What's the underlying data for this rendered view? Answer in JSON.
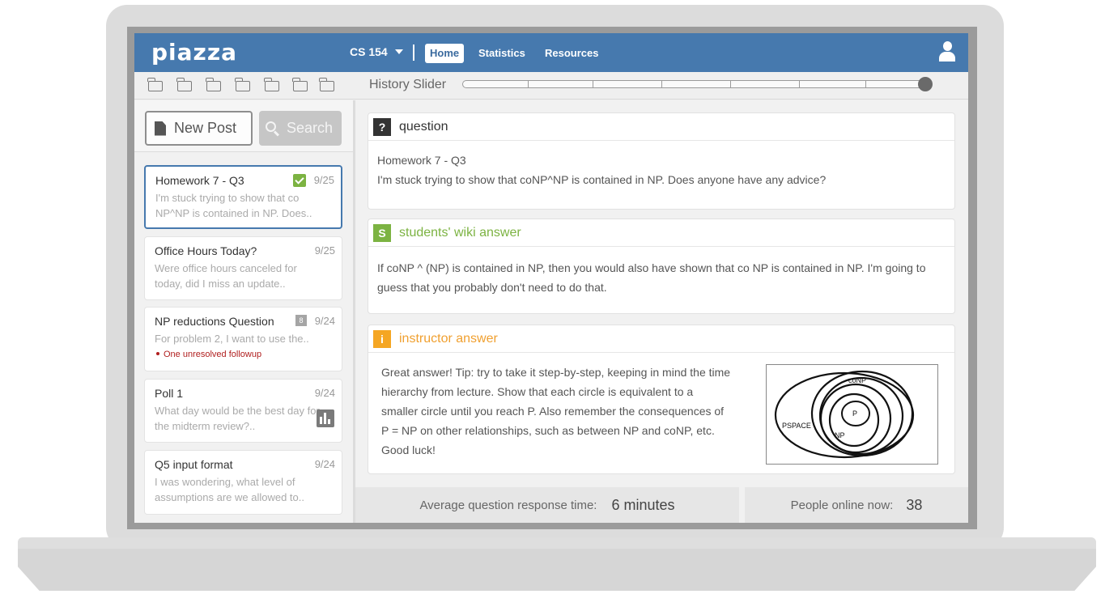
{
  "app": {
    "logo": "piazza"
  },
  "nav": {
    "course": "CS 154",
    "tabs": [
      {
        "label": "Home",
        "active": true
      },
      {
        "label": "Statistics",
        "active": false
      },
      {
        "label": "Resources",
        "active": false
      }
    ]
  },
  "history": {
    "label": "History Slider",
    "value_percent": 100
  },
  "actions": {
    "new_post": "New Post",
    "search": "Search"
  },
  "posts": [
    {
      "title": "Homework 7 - Q3",
      "date": "9/25",
      "snippet": "I'm stuck trying to show that co NP^NP is contained in NP.  Does.."
    },
    {
      "title": "Office Hours Today?",
      "date": "9/25",
      "snippet": "Were office hours canceled for today, did I miss an update.."
    },
    {
      "title": "NP reductions Question",
      "date": "9/24",
      "badge": "8",
      "snippet": "For problem 2, I want to use the..",
      "followup": "One unresolved followup"
    },
    {
      "title": "Poll 1",
      "date": "9/24",
      "snippet": "What day would be the best day for the midterm review?.."
    },
    {
      "title": "Q5 input format",
      "date": "9/24",
      "snippet": "I was wondering, what level of assumptions are we allowed to.."
    }
  ],
  "question": {
    "badge": "?",
    "label": "question",
    "title": "Homework 7 - Q3",
    "body": "I'm stuck trying to show that coNP^NP is contained in NP.  Does anyone have any advice?"
  },
  "student_answer": {
    "badge": "S",
    "label": "students' wiki answer",
    "body": "If coNP ^ (NP) is contained in NP, then you would also have shown that co NP is contained in NP. I'm going to guess that you probably don't need to do that."
  },
  "instructor_answer": {
    "badge": "i",
    "label": "instructor answer",
    "body": "Great answer! Tip: try to take it step-by-step, keeping in mind the time hierarchy from lecture. Show that each circle is equivalent to a smaller circle until you reach P.  Also remember the consequences of P = NP on other relationships, such as between NP and coNP, etc. Good luck!",
    "diagram_labels": {
      "pspace": "PSPACE",
      "conp": "coNP",
      "np": "NP",
      "p": "P"
    }
  },
  "stats": {
    "response_label": "Average question response time:",
    "response_value": "6 minutes",
    "online_label": "People online now:",
    "online_value": "38"
  },
  "colors": {
    "topbar": "#4679ae",
    "wiki_green": "#7cb342",
    "instructor_orange": "#f5a623",
    "followup_red": "#b01e1e"
  }
}
